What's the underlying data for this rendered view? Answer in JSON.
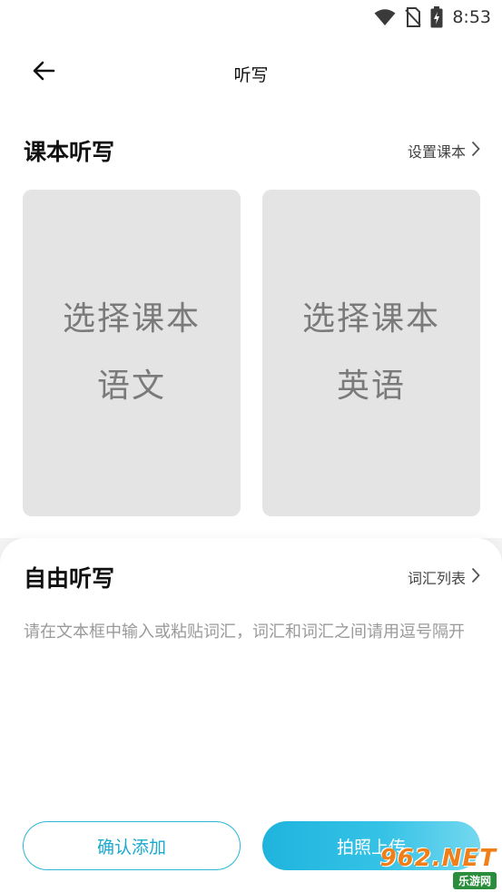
{
  "status_bar": {
    "time": "8:53",
    "icons": [
      "wifi-icon",
      "no-sim-icon",
      "battery-charging-icon"
    ]
  },
  "header": {
    "title": "听写",
    "back_icon": "arrow-left-icon"
  },
  "textbook_section": {
    "title": "课本听写",
    "link_label": "设置课本",
    "cards": [
      {
        "line1": "选择课本",
        "line2": "语文"
      },
      {
        "line1": "选择课本",
        "line2": "英语"
      }
    ]
  },
  "free_section": {
    "title": "自由听写",
    "link_label": "词汇列表",
    "input": {
      "value": "",
      "placeholder": "请在文本框中输入或粘贴词汇，词汇和词汇之间请用逗号隔开"
    }
  },
  "actions": {
    "confirm_label": "确认添加",
    "photo_label": "拍照上传"
  },
  "watermark": {
    "top": "962.NET",
    "bottom": "乐游网"
  },
  "colors": {
    "accent": "#1aa9cf",
    "card_bg": "#e4e4e4",
    "card_text": "#7a7a7a",
    "page_bg": "#f3f3f3"
  }
}
